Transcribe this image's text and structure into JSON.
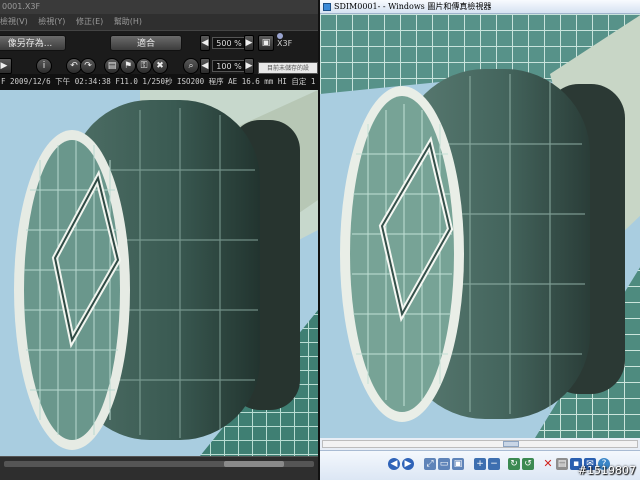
{
  "left_window": {
    "title": "0001.X3F",
    "menu": [
      "檢視(V)",
      "檢視(Y)",
      "修正(E)",
      "幫助(H)"
    ],
    "toolbar": {
      "save_as_label": "像另存為...",
      "fit_label": "適合",
      "zoom_value": "500 %",
      "zoom_value2": "100 %",
      "format_label": "X3F",
      "tooltip_text": "目前未儲存的設"
    },
    "info_line": "F 2009/12/6 下午 02:34:38 F11.0 1/250秒 ISO200 程序 AE  16.6 mm HI 自定 1"
  },
  "right_window": {
    "title": "SDIM0001- - Windows 圖片和傳真檢視器"
  },
  "watermark": "#1519807",
  "colors": {
    "sky": "#a9cde0",
    "glass": "#5c8a82",
    "frame": "#d8ddd2"
  }
}
